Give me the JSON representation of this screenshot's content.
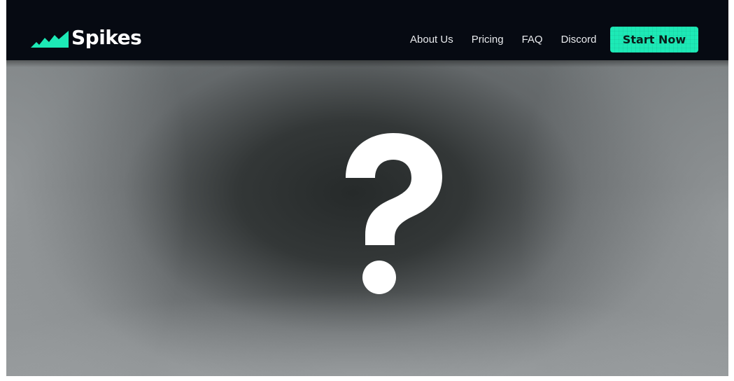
{
  "header": {
    "logo_text": "Spikes",
    "nav_items": [
      "About Us",
      "Pricing",
      "FAQ",
      "Discord"
    ],
    "cta_label": "Start Now"
  },
  "hero": {
    "icon": "question-mark-icon"
  },
  "colors": {
    "navbar_bg": "#060a12",
    "accent": "#1de9b6",
    "nav_text": "#e8eaed",
    "logo_text": "#ffffff",
    "hero_center": "#262a2a",
    "hero_edge": "#b4b8ba"
  },
  "icons": {
    "logo": "spikes-chart-logo-icon",
    "hero": "question-mark-icon"
  }
}
